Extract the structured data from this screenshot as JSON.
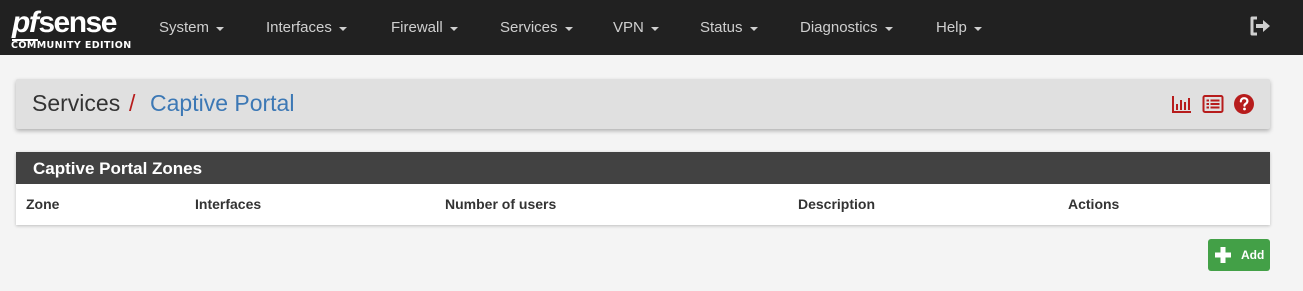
{
  "brand": {
    "logo_prefix": "pf",
    "logo_suffix": "sense",
    "edition": "COMMUNITY EDITION"
  },
  "navbar": {
    "items": [
      {
        "label": "System"
      },
      {
        "label": "Interfaces"
      },
      {
        "label": "Firewall"
      },
      {
        "label": "Services"
      },
      {
        "label": "VPN"
      },
      {
        "label": "Status"
      },
      {
        "label": "Diagnostics"
      },
      {
        "label": "Help"
      }
    ],
    "logout_icon": "sign-out-icon"
  },
  "breadcrumb": {
    "section": "Services",
    "separator": "/",
    "current": "Captive Portal",
    "icons": [
      "bar-chart-icon",
      "list-icon",
      "help-circle-icon"
    ]
  },
  "zones": {
    "title": "Captive Portal Zones",
    "columns": [
      "Zone",
      "Interfaces",
      "Number of users",
      "Description",
      "Actions"
    ],
    "rows": []
  },
  "add_button": {
    "label": "Add",
    "icon": "plus-icon"
  },
  "colors": {
    "navbar_bg": "#212121",
    "link_blue": "#3c78b5",
    "accent_red": "#b71c1c",
    "panel_heading_bg": "#424242",
    "success_green": "#43a047"
  }
}
